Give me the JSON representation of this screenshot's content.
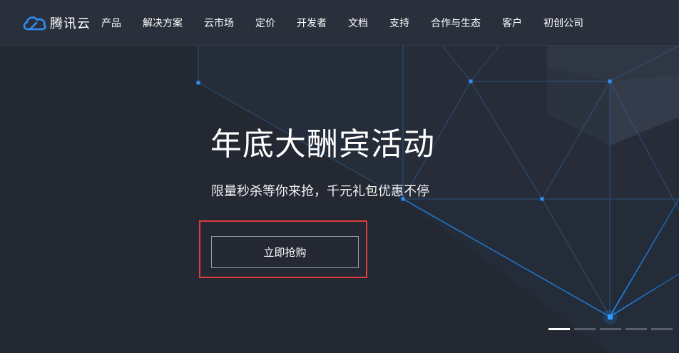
{
  "brand": {
    "name": "腾讯云",
    "accent": "#2e8ff2",
    "icon": "cloud-icon"
  },
  "nav": {
    "items": [
      "产品",
      "解决方案",
      "云市场",
      "定价",
      "开发者",
      "文档",
      "支持",
      "合作与生态",
      "客户",
      "初创公司"
    ]
  },
  "hero": {
    "title": "年底大酬宾活动",
    "subtitle": "限量秒杀等你来抢，千元礼包优惠不停",
    "cta_label": "立即抢购",
    "highlight_color": "#e03c3c"
  },
  "carousel": {
    "slide_count": 5,
    "active_index": 0
  }
}
